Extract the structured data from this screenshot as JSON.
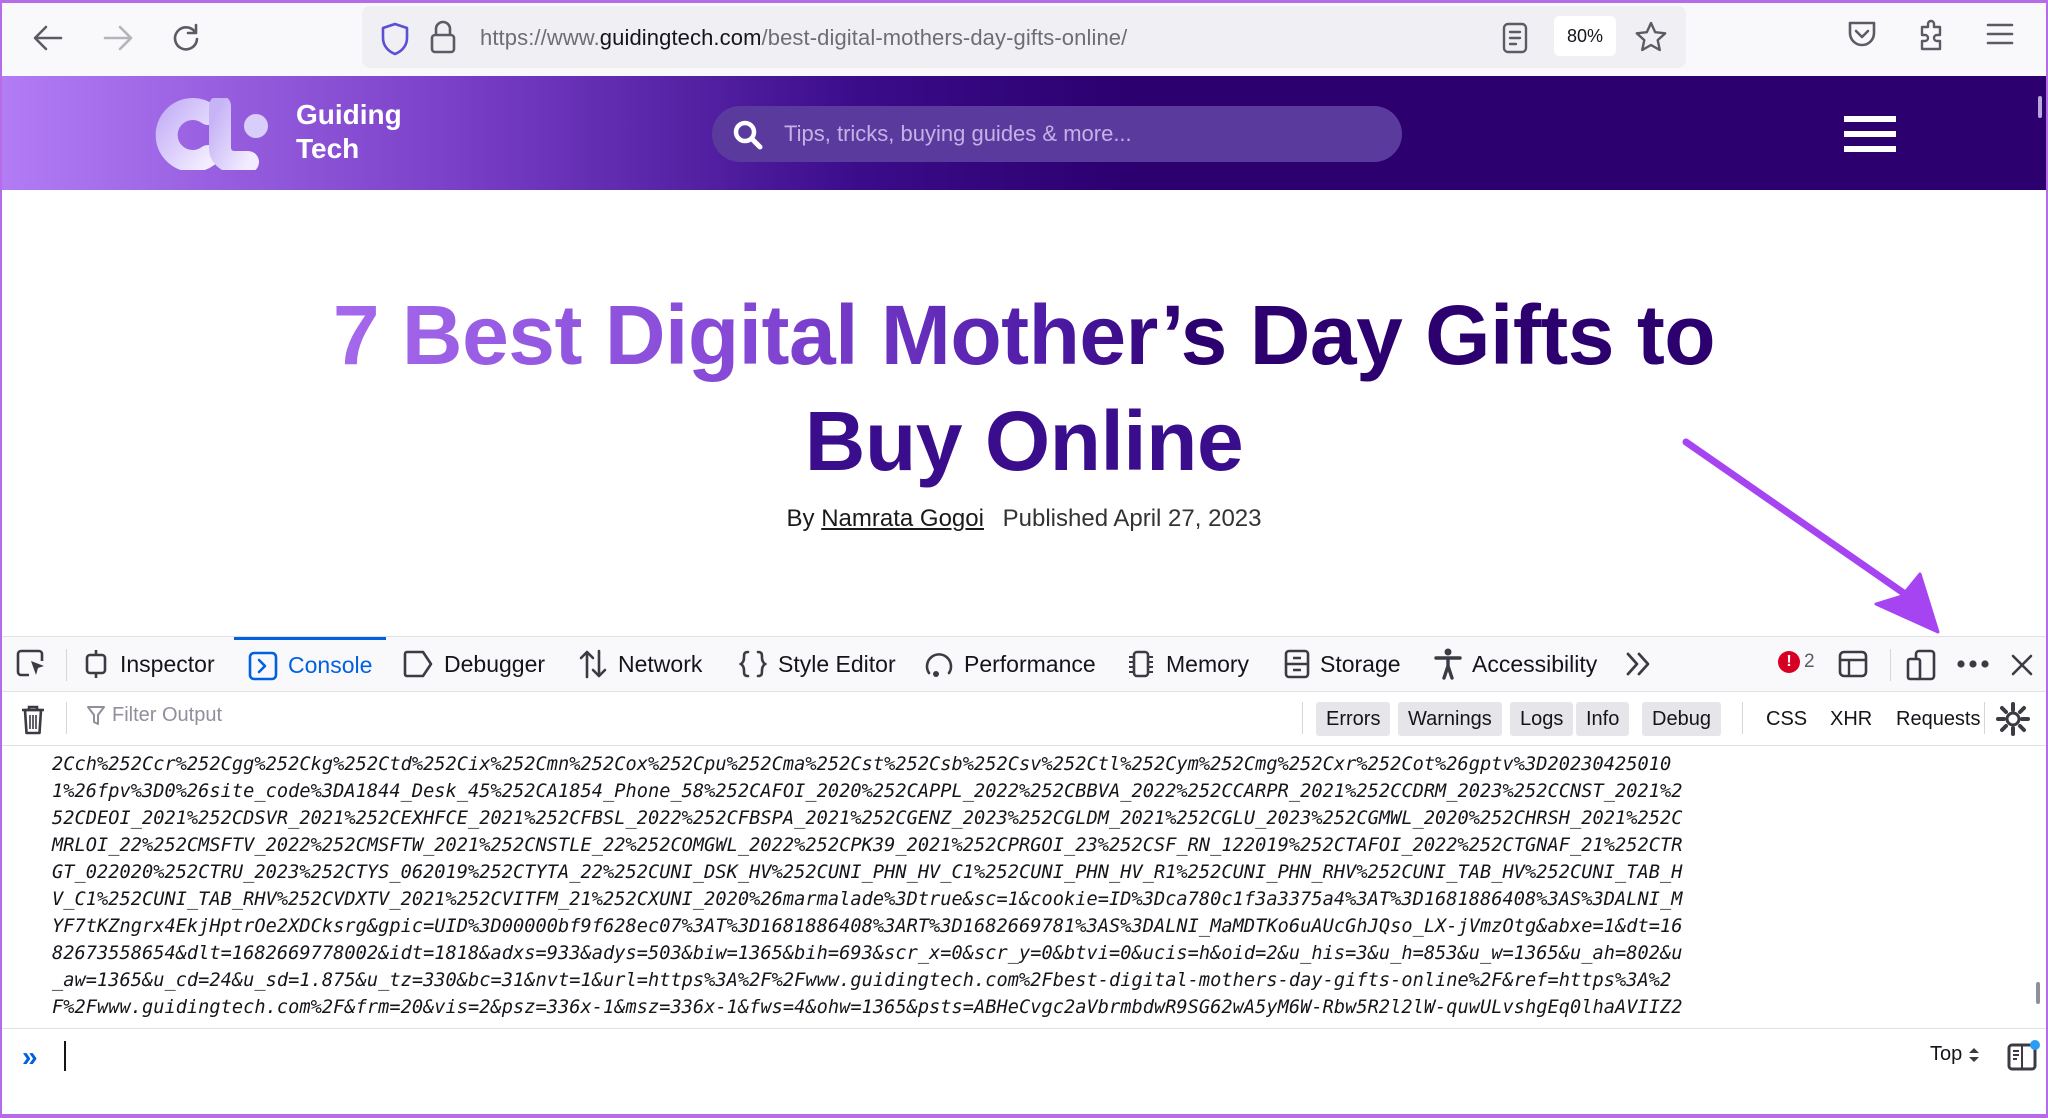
{
  "browser": {
    "url_prefix": "https://www.",
    "url_domain": "guidingtech.com",
    "url_path": "/best-digital-mothers-day-gifts-online/",
    "zoom_level": "80%",
    "icons": [
      "back-icon",
      "forward-icon",
      "reload-icon",
      "shield-icon",
      "lock-icon",
      "reader-view-icon",
      "star-icon",
      "pocket-icon",
      "extensions-icon",
      "menu-icon"
    ]
  },
  "site": {
    "logo_line1": "Guiding",
    "logo_line2": "Tech",
    "search_placeholder": "Tips, tricks, buying guides & more...",
    "brand_color": "#2c006f"
  },
  "article": {
    "title_line1": "7 Best Digital Mother’s Day Gifts to",
    "title_line2": "Buy Online",
    "by_label": "By",
    "author": "Namrata Gogoi",
    "published": "Published April 27, 2023"
  },
  "devtools": {
    "tabs": [
      {
        "label": "Inspector",
        "icon": "inspector-icon"
      },
      {
        "label": "Console",
        "icon": "console-icon",
        "active": true
      },
      {
        "label": "Debugger",
        "icon": "debugger-icon"
      },
      {
        "label": "Network",
        "icon": "network-icon"
      },
      {
        "label": "Style Editor",
        "icon": "style-editor-icon"
      },
      {
        "label": "Performance",
        "icon": "performance-icon"
      },
      {
        "label": "Memory",
        "icon": "memory-icon"
      },
      {
        "label": "Storage",
        "icon": "storage-icon"
      },
      {
        "label": "Accessibility",
        "icon": "accessibility-icon"
      }
    ],
    "error_count": "2",
    "error_color": "#d70022",
    "accent_color": "#0061e0",
    "filter_placeholder": "Filter Output",
    "level_filters": [
      "Errors",
      "Warnings",
      "Logs",
      "Info",
      "Debug"
    ],
    "type_filters": [
      "CSS",
      "XHR",
      "Requests"
    ],
    "context_selector": "Top",
    "console_lines": [
      "2Cch%252Ccr%252Cgg%252Ckg%252Ctd%252Cix%252Cmn%252Cox%252Cpu%252Cma%252Cst%252Csb%252Csv%252Ctl%252Cym%252Cmg%252Cxr%252Cot%26gptv%3D20230425010",
      "1%26fpv%3D0%26site_code%3DA1844_Desk_45%252CA1854_Phone_58%252CAFOI_2020%252CAPPL_2022%252CBBVA_2022%252CCARPR_2021%252CCDRM_2023%252CCNST_2021%2",
      "52CDEOI_2021%252CDSVR_2021%252CEXHFCE_2021%252CFBSL_2022%252CFBSPA_2021%252CGENZ_2023%252CGLDM_2021%252CGLU_2023%252CGMWL_2020%252CHRSH_2021%252C",
      "MRLOI_22%252CMSFTV_2022%252CMSFTW_2021%252CNSTLE_22%252COMGWL_2022%252CPK39_2021%252CPRGOI_23%252CSF_RN_122019%252CTAFOI_2022%252CTGNAF_21%252CTR",
      "GT_022020%252CTRU_2023%252CTYS_062019%252CTYTA_22%252CUNI_DSK_HV%252CUNI_PHN_HV_C1%252CUNI_PHN_HV_R1%252CUNI_PHN_RHV%252CUNI_TAB_HV%252CUNI_TAB_H",
      "V_C1%252CUNI_TAB_RHV%252CVDXTV_2021%252CVITFM_21%252CXUNI_2020%26marmalade%3Dtrue&sc=1&cookie=ID%3Dca780c1f3a3375a4%3AT%3D1681886408%3AS%3DALNI_M",
      "YF7tKZngrx4EkjHptrOe2XDCksrg&gpic=UID%3D00000bf9f628ec07%3AT%3D1681886408%3ART%3D1682669781%3AS%3DALNI_MaMDTKo6uAUcGhJQso_LX-jVmzOtg&abxe=1&dt=16",
      "82673558654&dlt=1682669778002&idt=1818&adxs=933&adys=503&biw=1365&bih=693&scr_x=0&scr_y=0&btvi=0&ucis=h&oid=2&u_his=3&u_h=853&u_w=1365&u_ah=802&u",
      "_aw=1365&u_cd=24&u_sd=1.875&u_tz=330&bc=31&nvt=1&url=https%3A%2F%2Fwww.guidingtech.com%2Fbest-digital-mothers-day-gifts-online%2F&ref=https%3A%2",
      "F%2Fwww.guidingtech.com%2F&frm=20&vis=2&psz=336x-1&msz=336x-1&fws=4&ohw=1365&psts=ABHeCvgc2aVbrmbdwR9SG62wA5yM6W-Rbw5R2l2lW-quwULvshgEq0lhaAVIIZ2"
    ],
    "console_input_value": ""
  },
  "annotation": {
    "arrow_color": "#a744f2",
    "points_to": "more-options-button"
  }
}
